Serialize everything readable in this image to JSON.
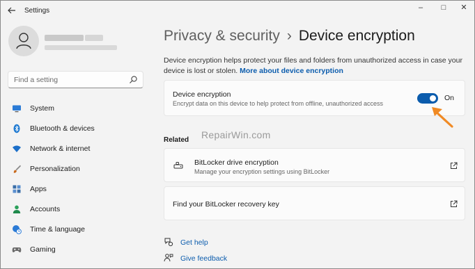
{
  "window": {
    "title": "Settings",
    "back_icon": "back-arrow-icon",
    "minimize_glyph": "–",
    "maximize_glyph": "□",
    "close_glyph": "✕"
  },
  "user": {
    "avatar_icon": "person-icon"
  },
  "search": {
    "placeholder": "Find a setting",
    "icon": "search-icon"
  },
  "nav": {
    "items": [
      {
        "label": "System",
        "icon": "monitor-icon",
        "color": "#2b7bd6"
      },
      {
        "label": "Bluetooth & devices",
        "icon": "bluetooth-icon",
        "color": "#1f7ad1"
      },
      {
        "label": "Network & internet",
        "icon": "wifi-icon",
        "color": "#1c6fc9"
      },
      {
        "label": "Personalization",
        "icon": "brush-icon",
        "color": "#c96a1c"
      },
      {
        "label": "Apps",
        "icon": "apps-icon",
        "color": "#3a6ea8"
      },
      {
        "label": "Accounts",
        "icon": "person-icon",
        "color": "#2aa05a"
      },
      {
        "label": "Time & language",
        "icon": "globe-clock-icon",
        "color": "#2b7bd6"
      },
      {
        "label": "Gaming",
        "icon": "gamepad-icon",
        "color": "#6b6b6b"
      }
    ]
  },
  "breadcrumb": {
    "parent": "Privacy & security",
    "separator": "›",
    "current": "Device encryption"
  },
  "description": {
    "text": "Device encryption helps protect your files and folders from unauthorized access in case your device is lost or stolen.",
    "link": "More about device encryption"
  },
  "encryption_card": {
    "title": "Device encryption",
    "subtitle": "Encrypt data on this device to help protect from offline, unauthorized access",
    "toggle_on": true,
    "toggle_state": "On"
  },
  "watermark": "RepairWin.com",
  "related": {
    "heading": "Related",
    "bitlocker": {
      "title": "BitLocker drive encryption",
      "subtitle": "Manage your encryption settings using BitLocker",
      "icon": "drive-lock-icon",
      "action_icon": "open-external-icon"
    },
    "recovery": {
      "title": "Find your BitLocker recovery key",
      "action_icon": "open-external-icon"
    }
  },
  "help": {
    "get_help": "Get help",
    "give_feedback": "Give feedback"
  },
  "colors": {
    "accent": "#0b5cad",
    "annotation_arrow": "#f08a24"
  }
}
